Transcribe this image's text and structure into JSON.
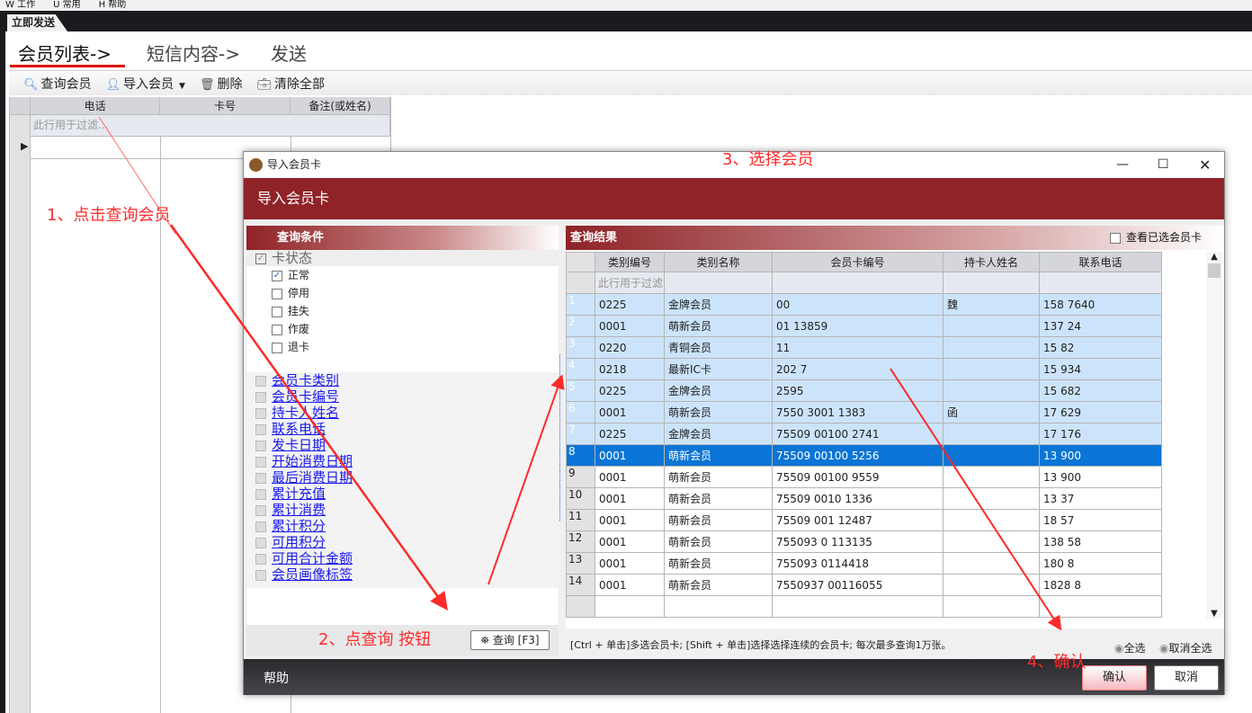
{
  "menu": [
    "W 工作",
    "U 常用",
    "H 帮助"
  ],
  "doc_tab": "立即发送",
  "steps": [
    "会员列表->",
    "短信内容->",
    "发送"
  ],
  "toolbar": {
    "query": "查询会员",
    "import": "导入会员",
    "delete": "删除",
    "clear": "清除全部"
  },
  "main_grid": {
    "columns": [
      "电话",
      "卡号",
      "备注(或姓名)"
    ],
    "filter_placeholder": "此行用于过滤..."
  },
  "dialog": {
    "title": "导入会员卡",
    "header": "导入会员卡",
    "conditions": {
      "title": "查询条件",
      "card_status": "卡状态",
      "statuses": [
        {
          "label": "正常",
          "checked": true
        },
        {
          "label": "停用",
          "checked": false
        },
        {
          "label": "挂失",
          "checked": false
        },
        {
          "label": "作废",
          "checked": false
        },
        {
          "label": "退卡",
          "checked": false
        }
      ],
      "fields": [
        "会员卡类别",
        "会员卡编号",
        "持卡人姓名",
        "联系电话",
        "发卡日期",
        "开始消费日期",
        "最后消费日期",
        "累计充值",
        "累计消费",
        "累计积分",
        "可用积分",
        "可用合计金额",
        "会员画像标签"
      ],
      "query_button": "查询 [F3]"
    },
    "results": {
      "title": "查询结果",
      "view_selected": "查看已选会员卡",
      "columns": [
        "类别编号",
        "类别名称",
        "会员卡编号",
        "持卡人姓名",
        "联系电话"
      ],
      "filter_placeholder": "此行用于过滤",
      "rows": [
        [
          "1",
          "0225",
          "金牌会员",
          "00",
          "魏",
          "158   7640"
        ],
        [
          "2",
          "0001",
          "萌新会员",
          "01    13859",
          "",
          "137   24"
        ],
        [
          "3",
          "0220",
          "青铜会员",
          "11",
          "",
          "15    82"
        ],
        [
          "4",
          "0218",
          "最新IC卡",
          "202   7",
          "",
          "15    934"
        ],
        [
          "5",
          "0225",
          "金牌会员",
          "2595",
          "",
          "15    682"
        ],
        [
          "6",
          "0001",
          "萌新会员",
          "7550   3001    1383",
          "函",
          "17    629"
        ],
        [
          "7",
          "0225",
          "金牌会员",
          "75509   00100   2741",
          "",
          "17    176"
        ],
        [
          "8",
          "0001",
          "萌新会员",
          "75509   00100   5256",
          "",
          "13    900"
        ],
        [
          "9",
          "0001",
          "萌新会员",
          "75509   00100   9559",
          "",
          "13    900"
        ],
        [
          "10",
          "0001",
          "萌新会员",
          "75509   0010    1336",
          "",
          "13    37"
        ],
        [
          "11",
          "0001",
          "萌新会员",
          "75509   001    12487",
          "",
          "18    57"
        ],
        [
          "12",
          "0001",
          "萌新会员",
          "755093   0    113135",
          "",
          "138   58"
        ],
        [
          "13",
          "0001",
          "萌新会员",
          "755093      0114418",
          "",
          "180   8"
        ],
        [
          "14",
          "0001",
          "萌新会员",
          "7550937     00116055",
          "",
          "1828   8"
        ]
      ],
      "selected_rows": [
        1,
        2,
        3,
        4,
        5,
        6,
        7
      ],
      "current_row": 8,
      "hint": "[Ctrl + 单击]多选会员卡; [Shift + 单击]选择选择连续的会员卡; 每次最多查询1万张。",
      "select_all": "全选",
      "deselect_all": "取消全选"
    },
    "help": "帮助",
    "confirm": "确认",
    "cancel": "取消"
  },
  "annotations": [
    "1、点击查询会员",
    "2、点查询 按钮",
    "3、选择会员",
    "4、确认"
  ],
  "colors": {
    "accent_red": "#8f2327",
    "selection": "#cce4fb",
    "current_row": "#0a75d6",
    "annotation": "#ff2a2a"
  }
}
